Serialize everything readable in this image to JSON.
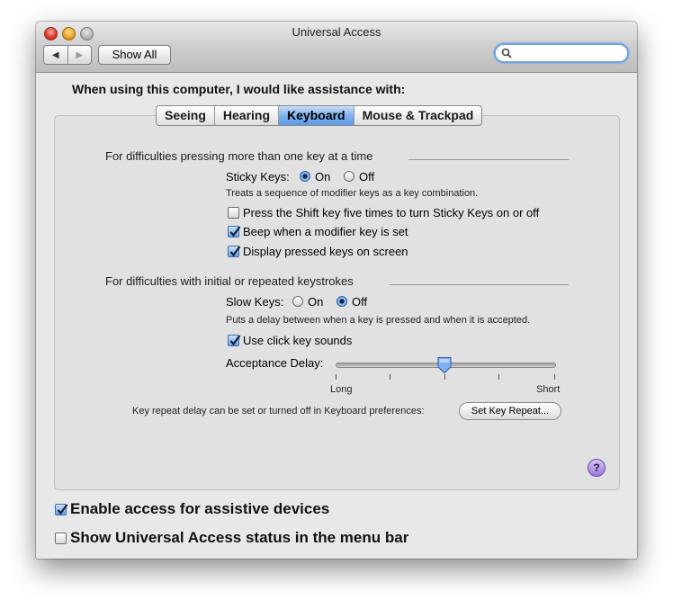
{
  "window": {
    "title": "Universal Access",
    "show_all_label": "Show All",
    "back_glyph": "◀",
    "forward_glyph": "▶",
    "search": {
      "placeholder": "",
      "value": ""
    }
  },
  "heading": "When using this computer, I would like assistance with:",
  "tabs": [
    {
      "label": "Seeing",
      "active": false
    },
    {
      "label": "Hearing",
      "active": false
    },
    {
      "label": "Keyboard",
      "active": true
    },
    {
      "label": "Mouse & Trackpad",
      "active": false
    }
  ],
  "sticky": {
    "section_label": "For difficulties pressing more than one key at a time",
    "label": "Sticky Keys:",
    "on_label": "On",
    "off_label": "Off",
    "selected": "On",
    "description": "Treats a sequence of modifier keys as a key combination.",
    "options": [
      {
        "label": "Press the Shift key five times to turn Sticky Keys on or off",
        "checked": false
      },
      {
        "label": "Beep when a modifier key is set",
        "checked": true
      },
      {
        "label": "Display pressed keys on screen",
        "checked": true
      }
    ]
  },
  "slow": {
    "section_label": "For difficulties with initial or repeated keystrokes",
    "label": "Slow Keys:",
    "on_label": "On",
    "off_label": "Off",
    "selected": "Off",
    "description": "Puts a delay between when a key is pressed and when it is accepted.",
    "click_sounds": {
      "label": "Use click key sounds",
      "checked": true
    },
    "delay": {
      "label": "Acceptance Delay:",
      "min_label": "Long",
      "max_label": "Short",
      "value_fraction": 0.5
    },
    "key_repeat_text": "Key repeat delay can be set or turned off in Keyboard preferences:",
    "key_repeat_button": "Set Key Repeat..."
  },
  "help_glyph": "?",
  "footer": {
    "assistive": {
      "label": "Enable access for assistive devices",
      "checked": true
    },
    "status_menu": {
      "label": "Show Universal Access status in the menu bar",
      "checked": false
    }
  },
  "colors": {
    "accent": "#5a9ae6",
    "help": "#9b79da"
  }
}
